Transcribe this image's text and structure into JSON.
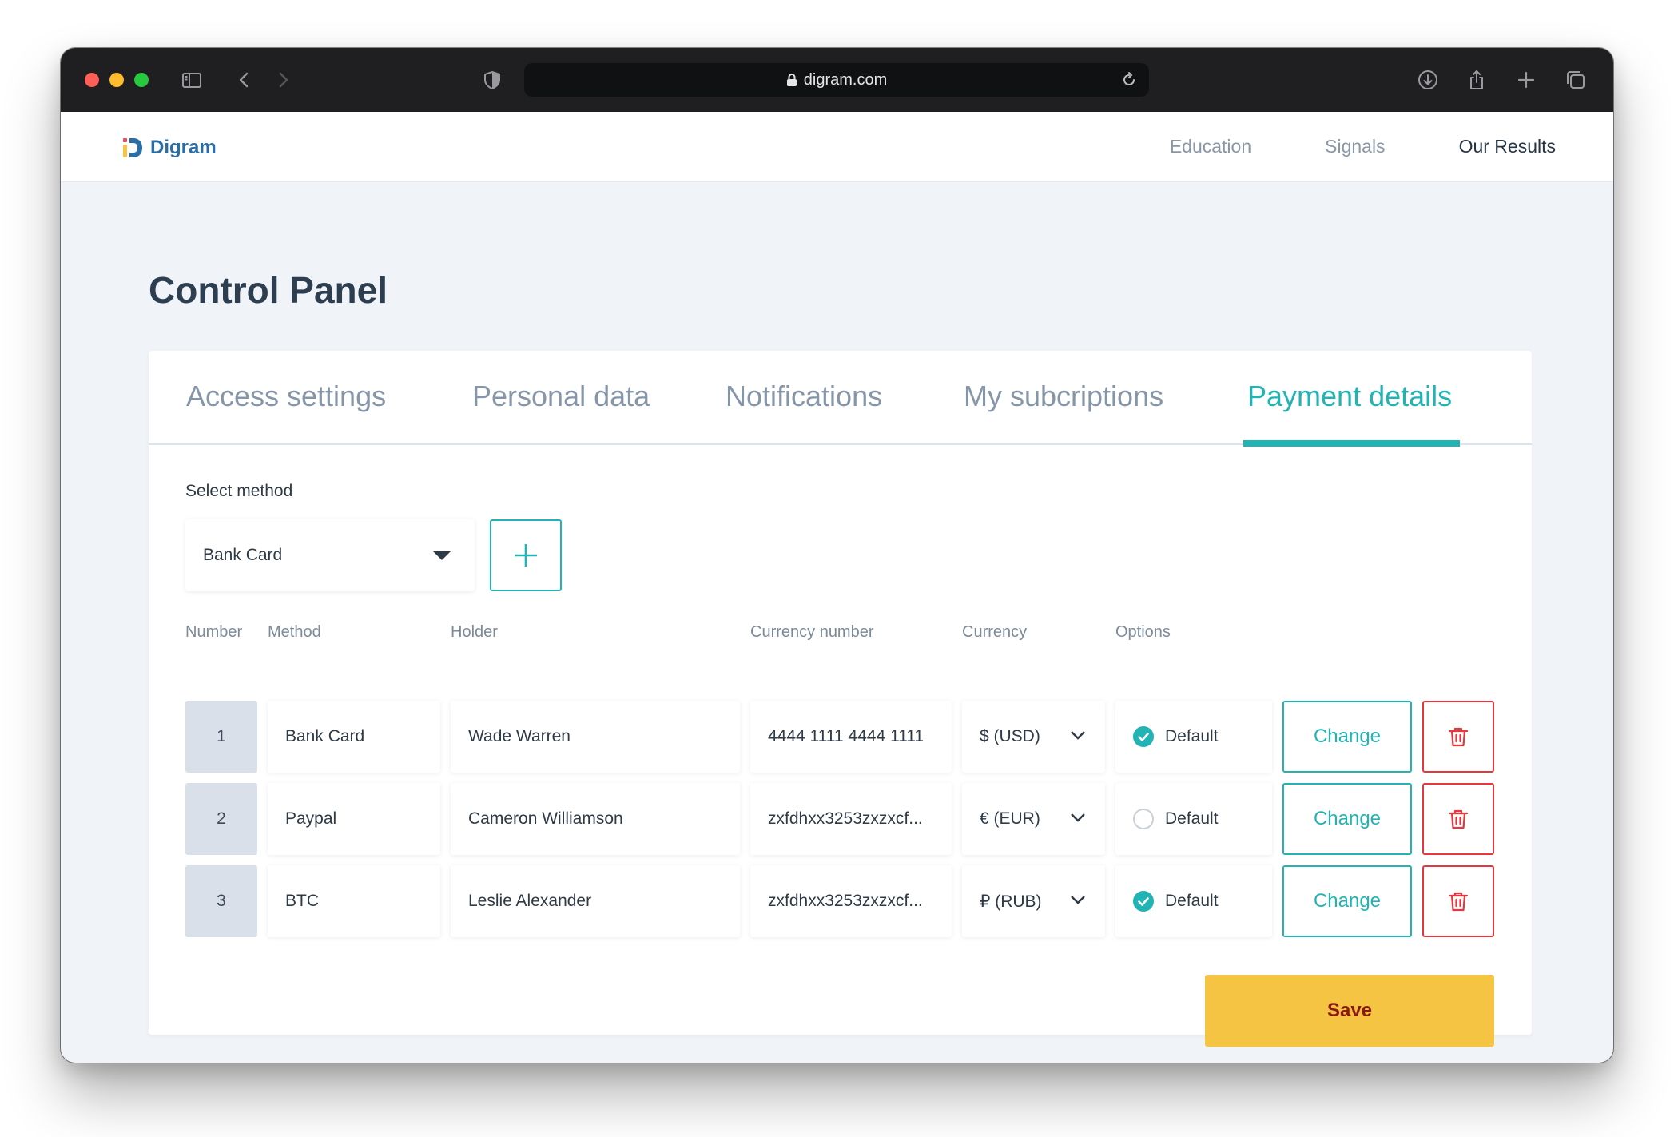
{
  "browser": {
    "url": "digram.com"
  },
  "header": {
    "logo_text": "Digram",
    "nav": [
      {
        "label": "Education"
      },
      {
        "label": "Signals"
      },
      {
        "label": "Our Results"
      }
    ]
  },
  "page": {
    "title": "Control Panel"
  },
  "tabs": [
    {
      "label": "Access settings"
    },
    {
      "label": "Personal data"
    },
    {
      "label": "Notifications"
    },
    {
      "label": "My subcriptions"
    },
    {
      "label": "Payment details",
      "active": true
    }
  ],
  "method_select": {
    "label": "Select method",
    "value": "Bank Card"
  },
  "table": {
    "headers": [
      "Number",
      "Method",
      "Holder",
      "Currency number",
      "Currency",
      "Options"
    ],
    "rows": [
      {
        "number": "1",
        "method": "Bank Card",
        "holder": "Wade Warren",
        "currency_number": "4444 1111 4444 1111",
        "currency": "$ (USD)",
        "option": "Default",
        "default": true,
        "action": "Change"
      },
      {
        "number": "2",
        "method": "Paypal",
        "holder": "Cameron Williamson",
        "currency_number": "zxfdhxx3253zxzxcf...",
        "currency": "€ (EUR)",
        "option": "Default",
        "default": false,
        "action": "Change"
      },
      {
        "number": "3",
        "method": "BTC",
        "holder": "Leslie Alexander",
        "currency_number": "zxfdhxx3253zxzxcf...",
        "currency": "₽ (RUB)",
        "option": "Default",
        "default": true,
        "action": "Change"
      }
    ]
  },
  "save_label": "Save",
  "colors": {
    "accent": "#22b3b5",
    "danger": "#e8373c",
    "save": "#f6c443",
    "title": "#2c3e50"
  }
}
